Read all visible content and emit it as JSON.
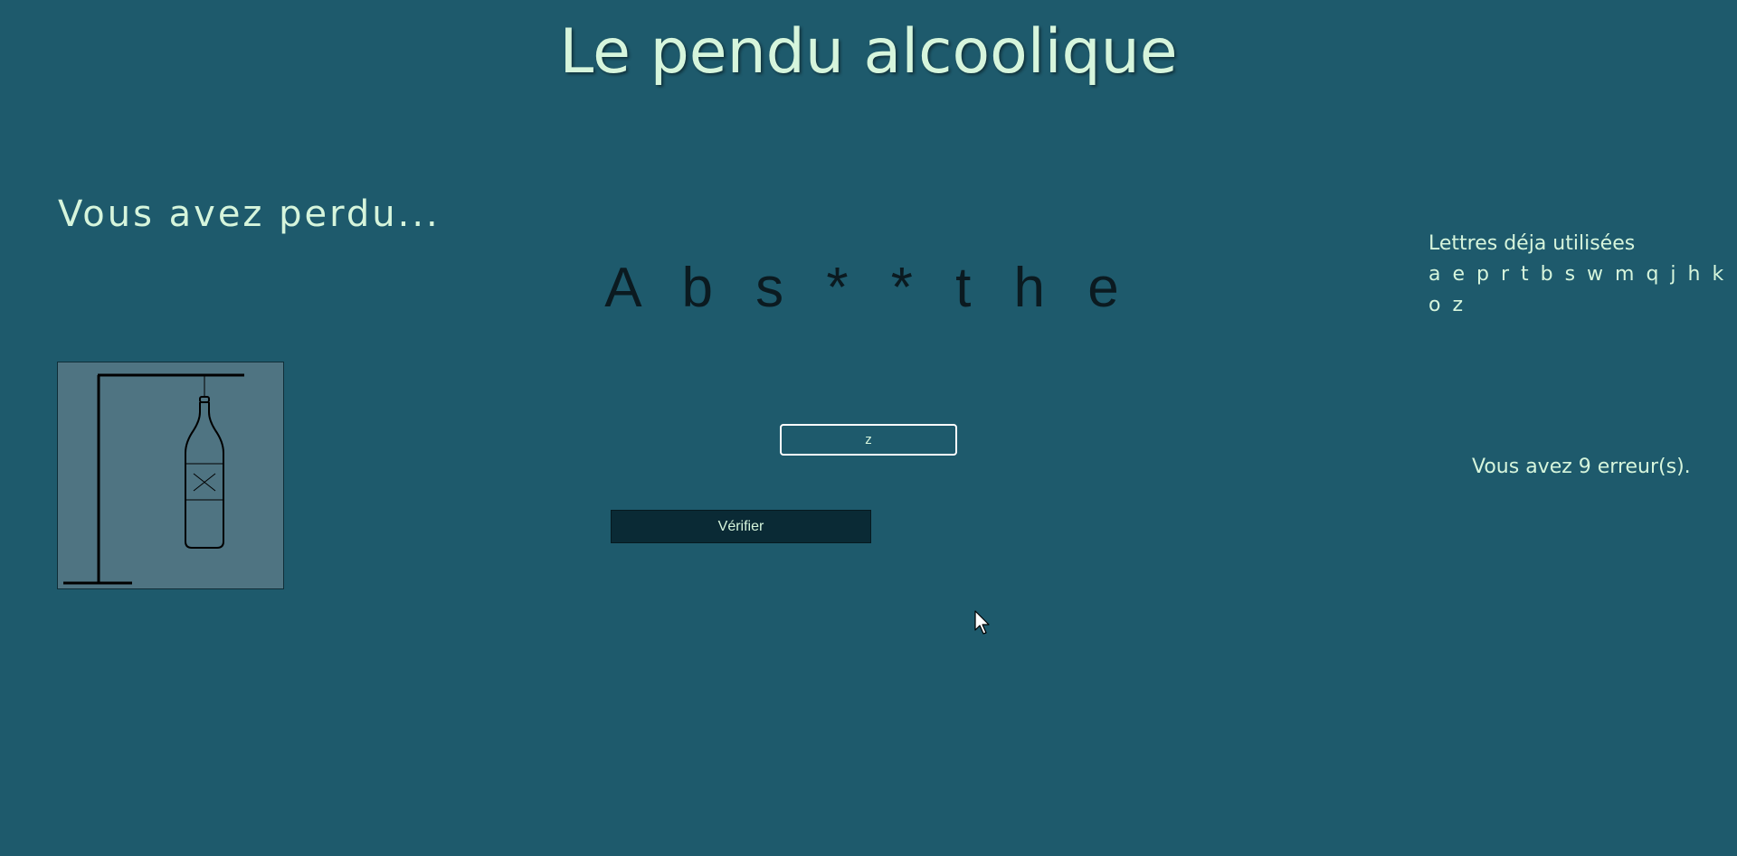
{
  "header": {
    "title": "Le pendu alcoolique"
  },
  "game": {
    "status_message": "Vous avez perdu...",
    "masked_word": "A b s * * t h e",
    "used_letters_label": "Lettres déja utilisées",
    "used_letters": "a e p r t b s w m q j h k o z",
    "errors_message": "Vous avez 9 erreur(s)."
  },
  "form": {
    "letter_input_value": "z",
    "verify_label": "Vérifier"
  },
  "icons": {
    "hangman": "bottle-hanging-icon",
    "cursor": "mouse-pointer-icon"
  },
  "colors": {
    "background": "#1e5a6c",
    "text": "#d6f5dc",
    "word": "#0b1a20",
    "button": "#0a2a35",
    "drawing_bg": "#4f7482"
  }
}
